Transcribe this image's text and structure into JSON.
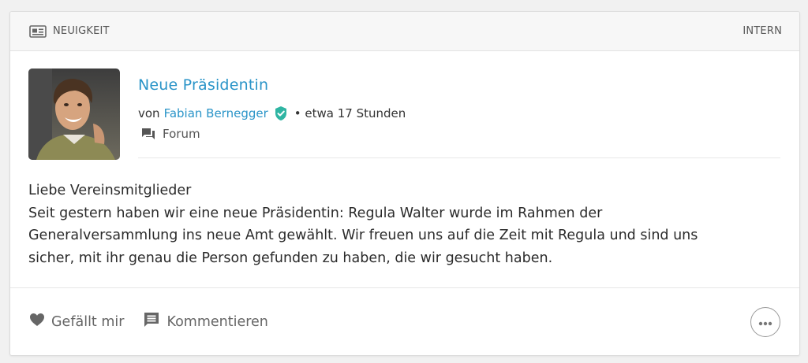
{
  "header": {
    "type_icon": "newspaper-icon",
    "type_label": "NEUIGKEIT",
    "visibility_label": "INTERN"
  },
  "post": {
    "title": "Neue Präsidentin",
    "by_prefix": "von",
    "author": "Fabian Bernegger",
    "verified_icon": "verified-badge-icon",
    "time": "• etwa 17 Stunden",
    "space_icon": "forum-icon",
    "space": "Forum",
    "body_lines": [
      "Liebe Vereinsmitglieder",
      "Seit gestern haben wir eine neue Präsidentin: Regula Walter wurde im Rahmen der",
      "Generalversammlung ins neue Amt gewählt. Wir freuen uns auf die Zeit mit Regula und sind uns",
      "sicher, mit ihr genau die Person gefunden zu haben, die wir gesucht haben."
    ]
  },
  "footer": {
    "like_icon": "heart-icon",
    "like_label": "Gefällt mir",
    "comment_icon": "comment-icon",
    "comment_label": "Kommentieren",
    "more_icon": "more-dots-icon"
  },
  "colors": {
    "link": "#2a94c8",
    "verified": "#2fb5a3",
    "icon_gray": "#666666"
  }
}
